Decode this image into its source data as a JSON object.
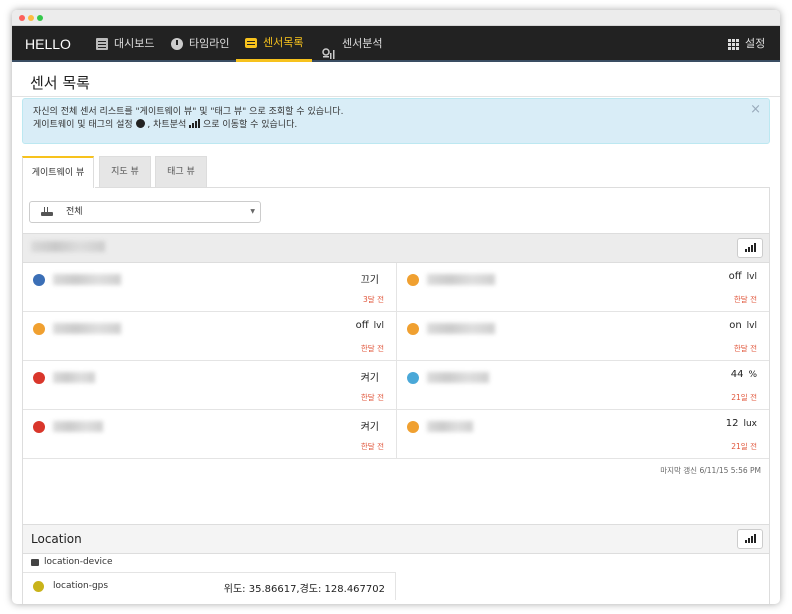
{
  "app": {
    "brand": "HELLO"
  },
  "nav": {
    "items": [
      {
        "label": "대시보드",
        "icon": "dashboard-icon"
      },
      {
        "label": "타임라인",
        "icon": "clock-icon"
      },
      {
        "label": "센서목록",
        "icon": "sensor-chip-icon",
        "active": true
      },
      {
        "label": "센서분석",
        "icon": "analytics-icon"
      }
    ],
    "settings_label": "설정"
  },
  "page": {
    "title": "센서 목록"
  },
  "alert": {
    "line1": "자신의 전체 센서 리스트를 \"게이트웨이 뷰\" 및 \"태그 뷰\" 으로 조회할 수 있습니다.",
    "line2_a": "게이트웨이 및 태그의 설정",
    "line2_b": ", 차트분석",
    "line2_c": "으로 이동할 수 있습니다.",
    "close": "×"
  },
  "tabs": [
    "게이트웨이 뷰",
    "지도 뷰",
    "태그 뷰"
  ],
  "filter": {
    "selected": "전체"
  },
  "sensors": [
    {
      "value": "끄기",
      "unit": "",
      "time": "3달 전",
      "icon_color": "#3b6fb6"
    },
    {
      "value": "off",
      "unit": "lvl",
      "time": "한달 전",
      "icon_color": "#f0a030"
    },
    {
      "value": "off",
      "unit": "lvl",
      "time": "한달 전",
      "icon_color": "#f0a030"
    },
    {
      "value": "on",
      "unit": "lvl",
      "time": "한달 전",
      "icon_color": "#f0a030"
    },
    {
      "value": "켜기",
      "unit": "",
      "time": "한달 전",
      "icon_color": "#d9362b"
    },
    {
      "value": "44",
      "unit": "%",
      "time": "21일 전",
      "icon_color": "#4aa8d8"
    },
    {
      "value": "켜기",
      "unit": "",
      "time": "한달 전",
      "icon_color": "#d9362b"
    },
    {
      "value": "12",
      "unit": "lux",
      "time": "21일 전",
      "icon_color": "#f0a030"
    }
  ],
  "updated": "마지막 갱신 6/11/15 5:56 PM",
  "location": {
    "title": "Location",
    "device": "location-device",
    "sensor_name": "location-gps",
    "sensor_value": "위도: 35.86617,경도: 128.467702"
  },
  "colors": {
    "accent": "#f7c21d",
    "navbar": "#222222",
    "alert_bg": "#d9edf7",
    "time_text": "#e0553a"
  }
}
